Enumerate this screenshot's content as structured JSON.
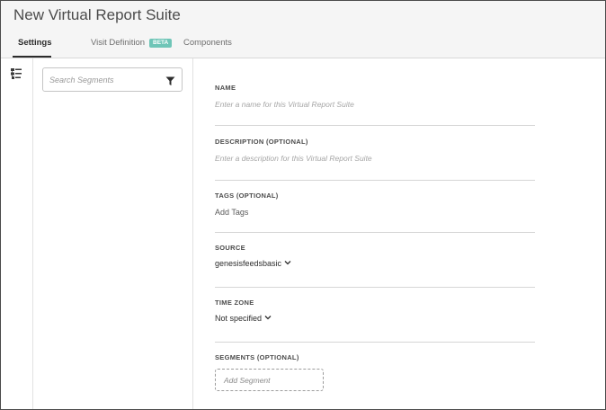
{
  "window": {
    "title": "New Virtual Report Suite"
  },
  "tabs": {
    "settings": "Settings",
    "visit_definition": "Visit Definition",
    "visit_badge": "BETA",
    "components": "Components",
    "active": "Settings"
  },
  "segment_panel": {
    "search_placeholder": "Search Segments",
    "rail_icon": "segment-list-icon",
    "filter_icon": "filter-funnel-icon"
  },
  "form": {
    "name_label": "NAME",
    "name_placeholder": "Enter a name for this Virtual Report Suite",
    "description_label": "DESCRIPTION (OPTIONAL)",
    "description_placeholder": "Enter a description for this Virtual Report Suite",
    "tags_label": "TAGS (OPTIONAL)",
    "tags_placeholder": "Add Tags",
    "source_label": "SOURCE",
    "source_value": "genesisfeedsbasic",
    "timezone_label": "TIME ZONE",
    "timezone_value": "Not specified",
    "segments_label": "SEGMENTS (OPTIONAL)",
    "add_segment": "Add Segment"
  },
  "colors": {
    "header_bg": "#f5f5f5",
    "beta_badge": "#6fc5b7",
    "text_dark": "#2c2c2c",
    "placeholder": "#a6a6a6",
    "divider": "#d6d6d6"
  }
}
